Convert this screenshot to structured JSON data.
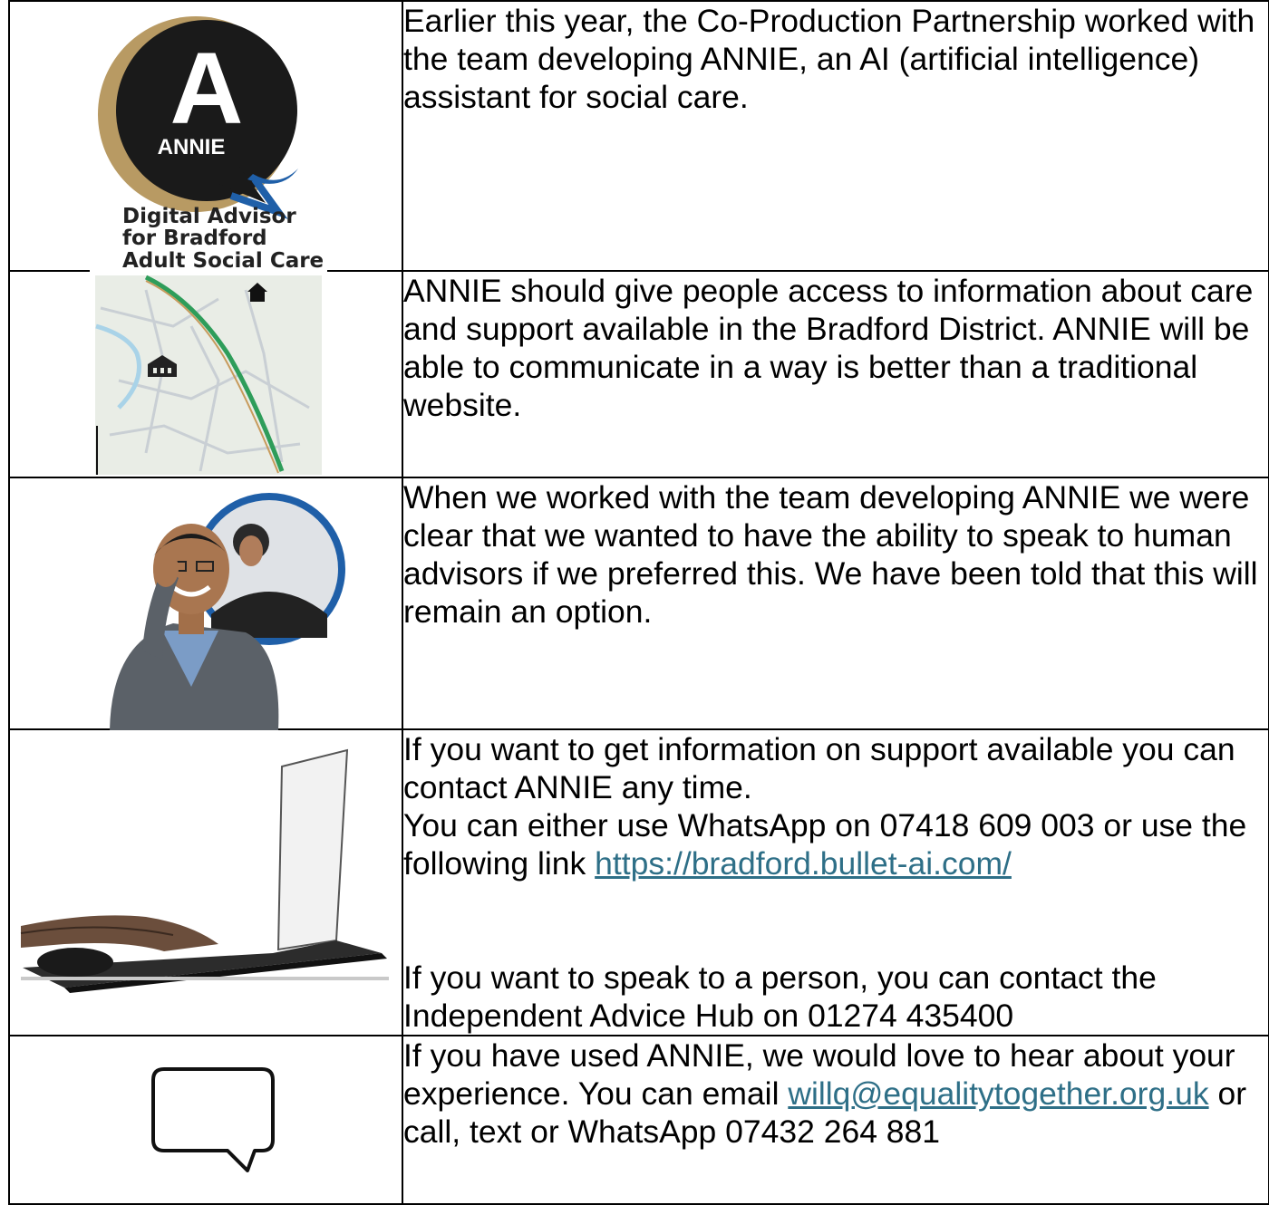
{
  "rows": [
    {
      "image": {
        "logo_letter": "A",
        "logo_name": "ANNIE",
        "caption_lines": [
          "Digital Advisor",
          "for Bradford",
          "Adult Social Care"
        ]
      },
      "text": "Earlier this year, the Co-Production Partnership worked with the team developing ANNIE, an AI (artificial intelligence) assistant for social care."
    },
    {
      "image": {
        "icons": [
          "home-icon",
          "school-icon"
        ]
      },
      "text": "ANNIE should give people access to information about care and support available in the Bradford District. ANNIE will be able to communicate in a way is better than a traditional website."
    },
    {
      "image": {},
      "text": "When we worked with the team developing ANNIE we were clear that we wanted to have the ability to speak to human advisors if we preferred this. We have been told that this will remain an option."
    },
    {
      "image": {},
      "line1": "If you want to get information on support available you can contact ANNIE any time.",
      "line2": "You can either use WhatsApp on 07418 609 003 or use the following link ",
      "link": "https://bradford.bullet-ai.com/",
      "line3": "If you want to speak to a person, you can contact the Independent Advice Hub on 01274 435400"
    },
    {
      "image": {
        "icon": "speech-bubble-icon"
      },
      "line1": "If you have used ANNIE, we would love to hear about your experience. You can email ",
      "email": "willq@equalitytogether.org.uk",
      "line2": " or call, text or WhatsApp 07432 264 881"
    }
  ],
  "colors": {
    "link": "#2e6f87",
    "logo_gold": "#b89a63",
    "logo_blue": "#1f5fa8",
    "map_route": "#2e9d5a"
  }
}
